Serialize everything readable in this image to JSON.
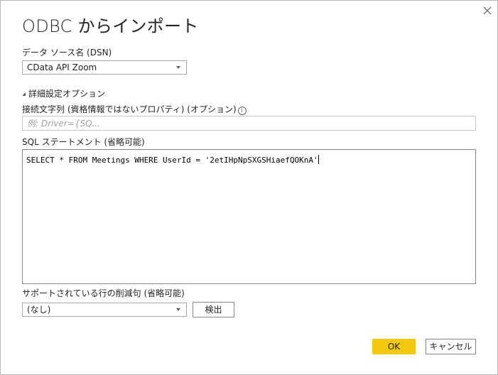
{
  "dialog": {
    "title": "ODBC からインポート"
  },
  "dsn": {
    "label": "データ ソース名 (DSN)",
    "selected": "CData API Zoom"
  },
  "advanced": {
    "toggle_label": "詳細設定オプション",
    "connection_string_label": "接続文字列 (資格情報ではないプロパティ) (オプション)",
    "connection_string_placeholder": "例: Driver={SQ...",
    "connection_string_value": "",
    "sql_label": "SQL ステートメント (省略可能)",
    "sql_value": "SELECT * FROM Meetings WHERE UserId = '2etIHpNpSXGSHiaefQOKnA'",
    "clauses_label": "サポートされている行の削減句 (省略可能)",
    "clauses_selected": "(なし)",
    "detect_label": "検出"
  },
  "footer": {
    "ok_label": "OK",
    "cancel_label": "キャンセル"
  },
  "colors": {
    "primary": "#f2c811",
    "text": "#252423",
    "border": "#8a8886"
  },
  "icons": {
    "close": "close-icon",
    "info": "info-icon",
    "caret": "chevron-down-icon",
    "collapse": "collapse-triangle-icon"
  }
}
